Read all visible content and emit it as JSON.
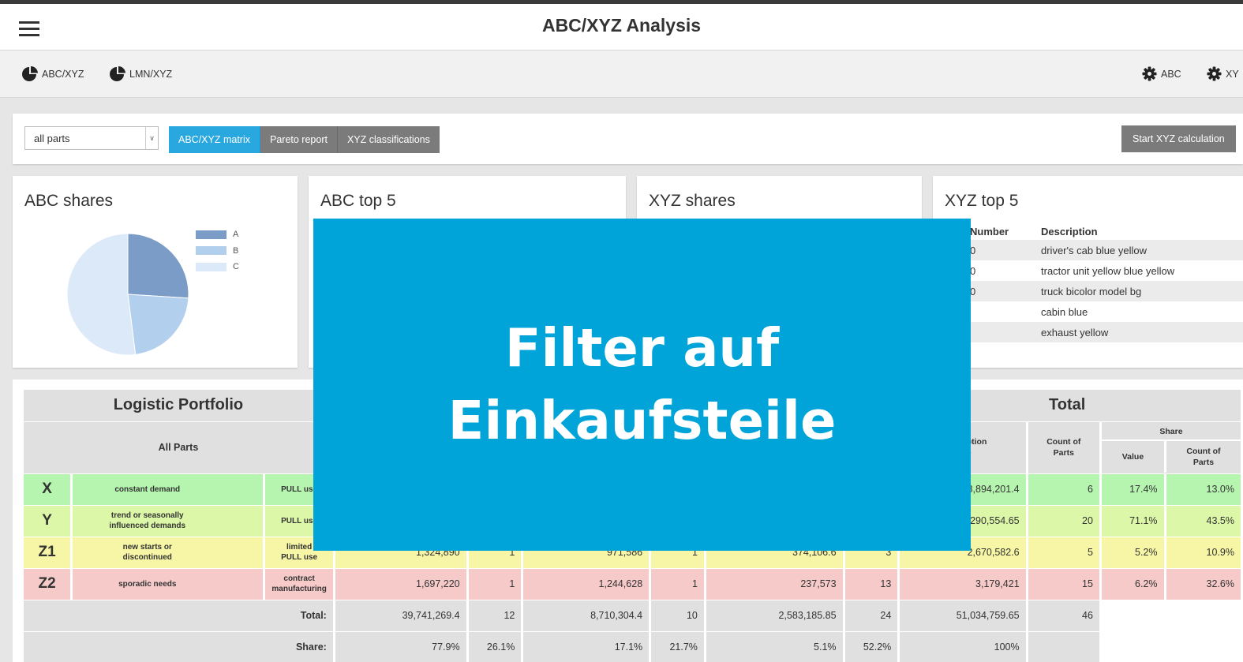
{
  "app": {
    "title": "ABC/XYZ Analysis"
  },
  "nav": {
    "left": [
      {
        "label": "ABC/XYZ",
        "icon": "pie-chart-icon"
      },
      {
        "label": "LMN/XYZ",
        "icon": "pie-chart-icon"
      }
    ],
    "right": [
      {
        "label": "ABC",
        "icon": "gear-icon"
      },
      {
        "label": "XY",
        "icon": "gear-icon"
      }
    ]
  },
  "filter": {
    "selected": "all parts",
    "tabs": [
      {
        "label": "ABC/XYZ matrix",
        "active": true
      },
      {
        "label": "Pareto report",
        "active": false
      },
      {
        "label": "XYZ classifications",
        "active": false
      }
    ],
    "start_button": "Start XYZ calculation"
  },
  "cards": {
    "abc_shares": {
      "title": "ABC shares",
      "legend": [
        {
          "label": "A",
          "color": "#7a9cc6"
        },
        {
          "label": "B",
          "color": "#b3cfee"
        },
        {
          "label": "C",
          "color": "#dce9f9"
        }
      ]
    },
    "abc_top5": {
      "title": "ABC top 5"
    },
    "xyz_shares": {
      "title": "XYZ shares"
    },
    "xyz_top5": {
      "title": "XYZ top 5",
      "headers": [
        "Number",
        "Description"
      ],
      "rows": [
        {
          "number": "0",
          "description": "driver's cab blue yellow"
        },
        {
          "number": "0",
          "description": "tractor unit yellow blue yellow"
        },
        {
          "number": "0",
          "description": "truck bicolor model bg"
        },
        {
          "number": "",
          "description": "cabin blue"
        },
        {
          "number": "",
          "description": "exhaust yellow"
        }
      ]
    }
  },
  "chart_data": {
    "type": "pie",
    "categories": [
      "A",
      "B",
      "C"
    ],
    "values": [
      26,
      22,
      52
    ],
    "legend": "top-right"
  },
  "matrix": {
    "left_title": "Logistic Portfolio",
    "all_parts": "All Parts",
    "total_title": "Total",
    "total_headers": {
      "consumption": "nption\nue",
      "count": "Count of\nParts",
      "share": "Share",
      "share_value": "Value",
      "share_count": "Count of\nParts"
    },
    "rows": [
      {
        "letter": "X",
        "demand": "constant demand",
        "use": "PULL use",
        "cells": [],
        "total": {
          "consumption": "8,894,201.4",
          "count": "6",
          "share_value": "17.4%",
          "share_count": "13.0%"
        }
      },
      {
        "letter": "Y",
        "demand": "trend or seasonally\ninfluenced demands",
        "use": "PULL use",
        "cells": [],
        "total": {
          "consumption": "6,290,554.65",
          "count": "20",
          "share_value": "71.1%",
          "share_count": "43.5%"
        }
      },
      {
        "letter": "Z1",
        "demand": "new starts or\ndiscontinued",
        "use": "limited\nPULL use",
        "cells": [
          "1,324,890",
          "1",
          "971,586",
          "1",
          "374,106.6",
          "3"
        ],
        "total": {
          "consumption": "2,670,582.6",
          "count": "5",
          "share_value": "5.2%",
          "share_count": "10.9%"
        }
      },
      {
        "letter": "Z2",
        "demand": "sporadic needs",
        "use": "contract\nmanufacturing",
        "cells": [
          "1,697,220",
          "1",
          "1,244,628",
          "1",
          "237,573",
          "13"
        ],
        "total": {
          "consumption": "3,179,421",
          "count": "15",
          "share_value": "6.2%",
          "share_count": "32.6%"
        }
      }
    ],
    "total_row": {
      "label": "Total:",
      "cells": [
        "39,741,269.4",
        "12",
        "8,710,304.4",
        "10",
        "2,583,185.85",
        "24"
      ],
      "consumption": "51,034,759.65",
      "count": "46"
    },
    "share_row": {
      "label": "Share:",
      "cells": [
        "77.9%",
        "26.1%",
        "17.1%",
        "21.7%",
        "5.1%",
        "52.2%"
      ],
      "consumption": "100%"
    }
  },
  "overlay": {
    "line1": "Filter auf",
    "line2": "Einkaufsteile"
  }
}
